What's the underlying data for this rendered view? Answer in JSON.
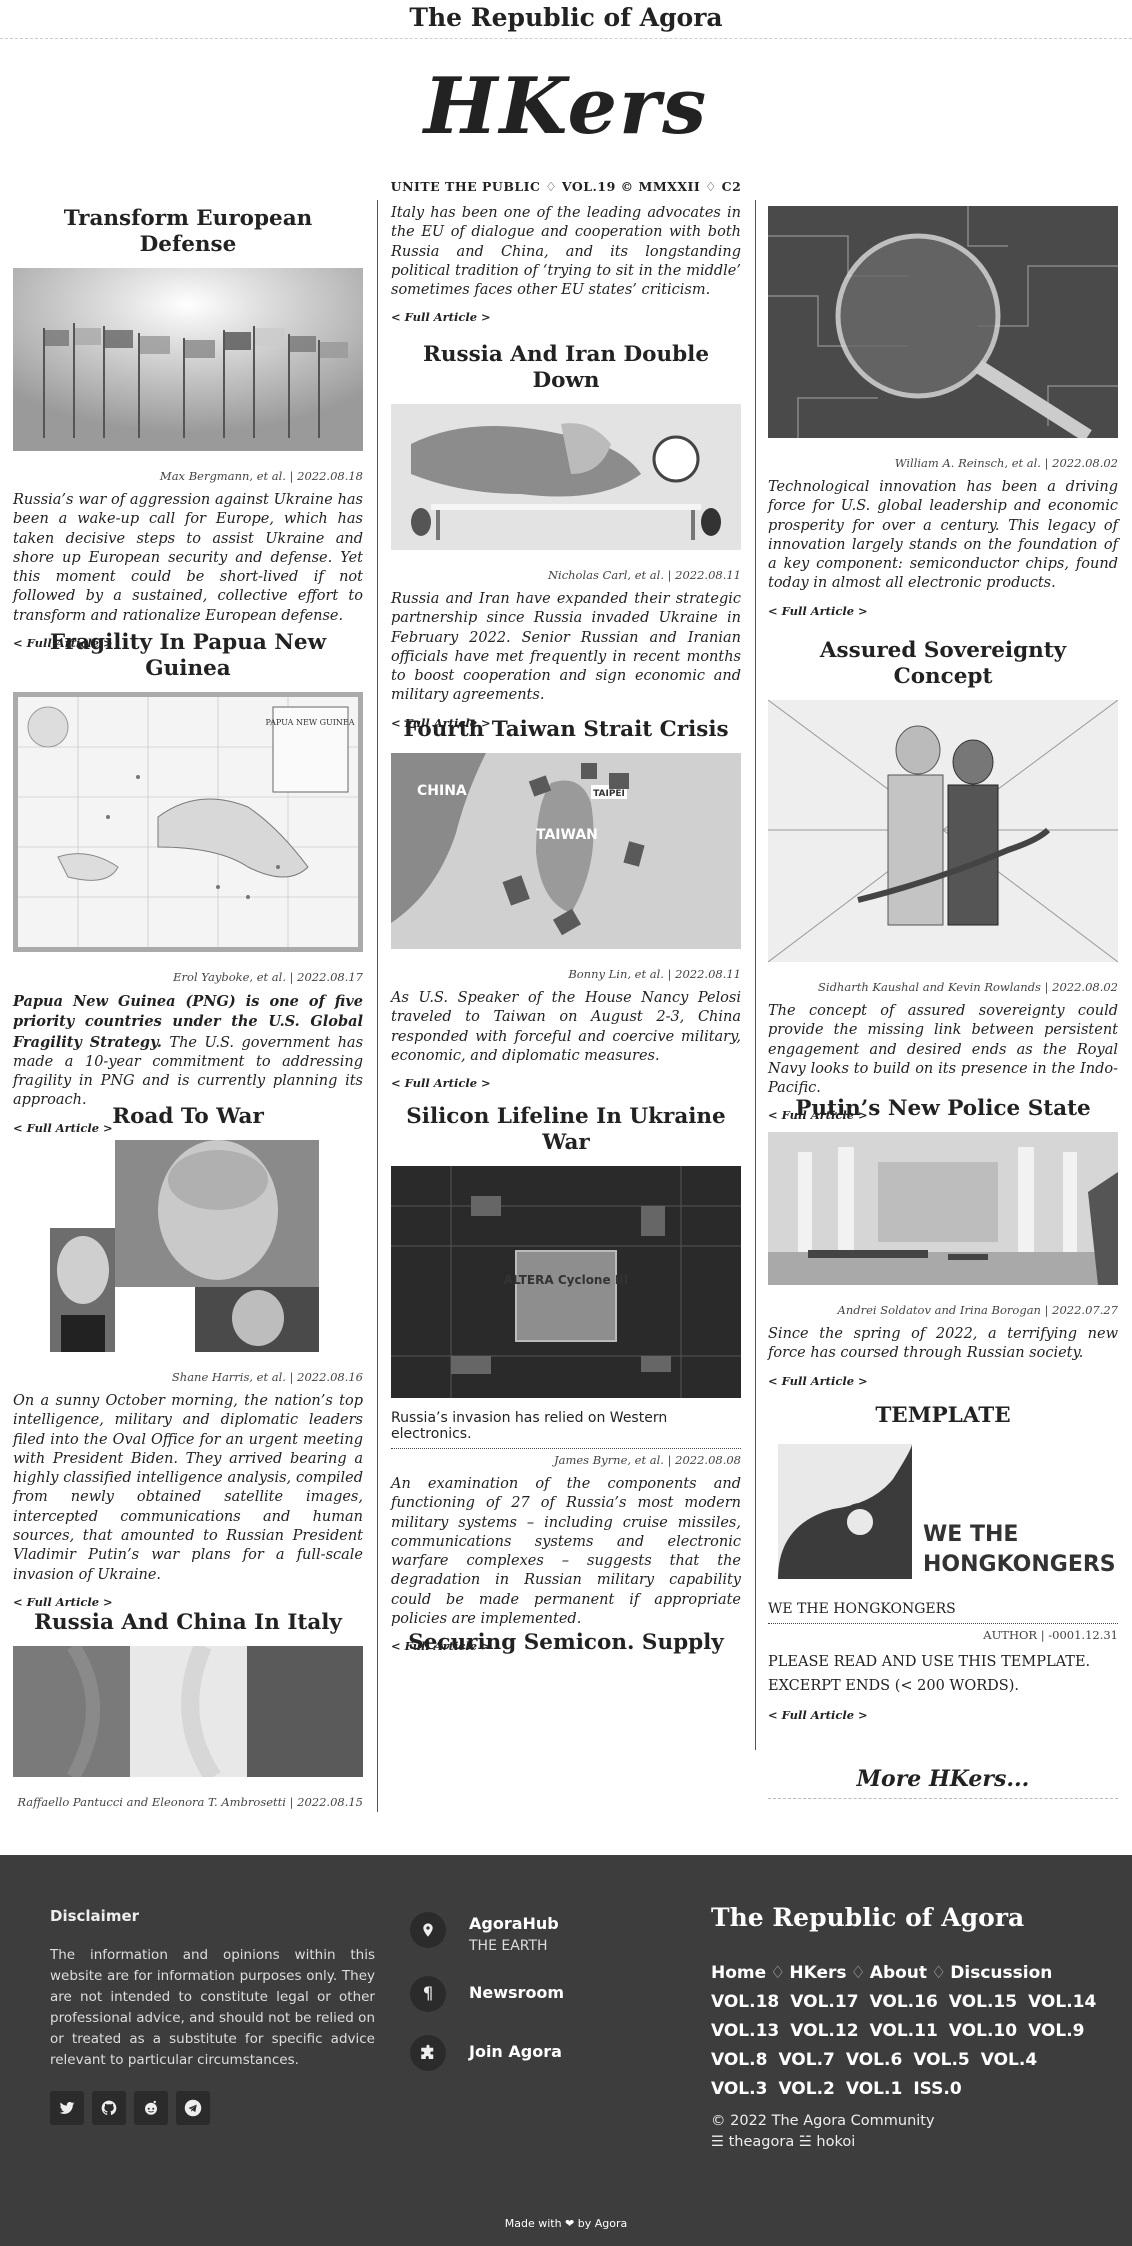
{
  "site": {
    "top_title": "The Republic of Agora",
    "masthead": "HKers",
    "issue_line": "UNITE THE PUBLIC ♢ VOL.19 © MMXXII ♢ C2"
  },
  "col1": [
    {
      "title": "Transform European Defense",
      "byline": "Max Bergmann, et al. | 2022.08.18",
      "excerpt": "Russia’s war of aggression against Ukraine has been a wake-up call for Europe, which has taken decisive steps to assist Ukraine and shore up European security and defense. Yet this moment could be short-lived if not followed by a sustained, collective effort to transform and rationalize European defense.",
      "more": "< Full Article >"
    },
    {
      "title": "Fragility In Papua New Guinea",
      "byline": "Erol Yayboke, et al. | 2022.08.17",
      "excerpt_bold": "Papua New Guinea (PNG) is one of five priority countries under the U.S. Global Fragility Strategy.",
      "excerpt": " The U.S. government has made a 10-year commitment to addressing fragility in PNG and is currently planning its approach.",
      "more": "< Full Article >",
      "map_title": "PAPUA NEW GUINEA"
    },
    {
      "title": "Road To War",
      "byline": "Shane Harris, et al. | 2022.08.16",
      "excerpt": "On a sunny October morning, the nation’s top intelligence, military and diplomatic leaders filed into the Oval Office for an urgent meeting with President Biden. They arrived bearing a highly classified intelligence analysis, compiled from newly obtained satellite images, intercepted communications and human sources, that amounted to Russian President Vladimir Putin’s war plans for a full-scale invasion of Ukraine.",
      "more": "< Full Article >"
    },
    {
      "title": "Russia And China In Italy",
      "byline": "Raffaello Pantucci and Eleonora T. Ambrosetti | 2022.08.15"
    }
  ],
  "col2": [
    {
      "excerpt": "Italy has been one of the leading advocates in the EU of dialogue and cooperation with both Russia and China, and its longstanding political tradition of ‘trying to sit in the middle’ sometimes faces other EU states’ criticism.",
      "more": "< Full Article >"
    },
    {
      "title": "Russia And Iran Double Down",
      "byline": "Nicholas Carl, et al. | 2022.08.11",
      "excerpt": "Russia and Iran have expanded their strategic partnership since Russia invaded Ukraine in February 2022. Senior Russian and Iranian officials have met frequently in recent months to boost cooperation and sign economic and military agreements.",
      "more": "< Full Article >"
    },
    {
      "title": "Fourth Taiwan Strait Crisis",
      "byline": "Bonny Lin, et al. | 2022.08.11",
      "excerpt": "As U.S. Speaker of the House Nancy Pelosi traveled to Taiwan on August 2-3, China responded with forceful and coercive military, economic, and diplomatic measures.",
      "more": "< Full Article >",
      "map_labels": {
        "china": "CHINA",
        "taiwan": "TAIWAN",
        "taipei": "TAIPEI"
      }
    },
    {
      "title": "Silicon Lifeline In Ukraine War",
      "subtitle": "Russia’s invasion has relied on Western electronics.",
      "byline": "James Byrne, et al. | 2022.08.08",
      "excerpt": "An examination of the components and functioning of 27 of Russia’s most modern military systems – including cruise missiles, communications systems and electronic warfare complexes – suggests that the degradation in Russian military capability could be made permanent if appropriate policies are implemented.",
      "more": "< Full Article >",
      "chip_text": "ALTERA Cyclone III"
    },
    {
      "title": "Securing Semicon. Supply"
    }
  ],
  "col3": [
    {
      "byline": "William A. Reinsch, et al. | 2022.08.02",
      "excerpt": "Technological innovation has been a driving force for U.S. global leadership and economic prosperity for over a century. This legacy of innovation largely stands on the foundation of a key component: semiconductor chips, found today in almost all electronic products.",
      "more": "< Full Article >"
    },
    {
      "title": "Assured Sovereignty Concept",
      "byline": "Sidharth Kaushal and Kevin Rowlands | 2022.08.02",
      "excerpt": "The concept of assured sovereignty could provide the missing link between persistent engagement and desired ends as the Royal Navy looks to build on its presence in the Indo-Pacific.",
      "more": "< Full Article >"
    },
    {
      "title": "Putin’s New Police State",
      "byline": "Andrei Soldatov and Irina Borogan | 2022.07.27",
      "excerpt": "Since the spring of 2022, a terrifying new force has coursed through Russian society.",
      "more": "< Full Article >"
    },
    {
      "title": "TEMPLATE",
      "logo_text_1": "WE THE",
      "logo_text_2": "HONGKONGERS",
      "subtitle": "WE THE HONGKONGERS",
      "byline": "AUTHOR | -0001.12.31",
      "excerpt": "PLEASE READ AND USE THIS TEMPLATE. EXCERPT ENDS (< 200 WORDS).",
      "more": "< Full Article >"
    },
    {
      "more_link": "More HKers..."
    }
  ],
  "footer": {
    "disclaimer_title": "Disclaimer",
    "disclaimer_text": "The information and opinions within this website are for information purposes only. They are not intended to constitute legal or other professional advice, and should not be relied on or treated as a substitute for specific advice relevant to particular circumstances.",
    "social_icons": [
      "twitter-icon",
      "github-icon",
      "reddit-icon",
      "telegram-icon"
    ],
    "nav": [
      {
        "title": "AgoraHub",
        "sub": "THE EARTH",
        "icon": "map-pin-icon"
      },
      {
        "title": "Newsroom",
        "sub": "",
        "icon": "paragraph-icon"
      },
      {
        "title": "Join Agora",
        "sub": "",
        "icon": "puzzle-icon"
      }
    ],
    "brand": "The Republic of Agora",
    "links": [
      "Home",
      "HKers",
      "About",
      "Discussion"
    ],
    "link_sep": "♢",
    "volumes": [
      "VOL.18",
      "VOL.17",
      "VOL.16",
      "VOL.15",
      "VOL.14",
      "VOL.13",
      "VOL.12",
      "VOL.11",
      "VOL.10",
      "VOL.9",
      "VOL.8",
      "VOL.7",
      "VOL.6",
      "VOL.5",
      "VOL.4",
      "VOL.3",
      "VOL.2",
      "VOL.1",
      "ISS.0"
    ],
    "copyright": "© 2022 The Agora Community",
    "handle": "☰ theagora ☱ hokoi",
    "made_with": "Made with ❤ by Agora"
  }
}
